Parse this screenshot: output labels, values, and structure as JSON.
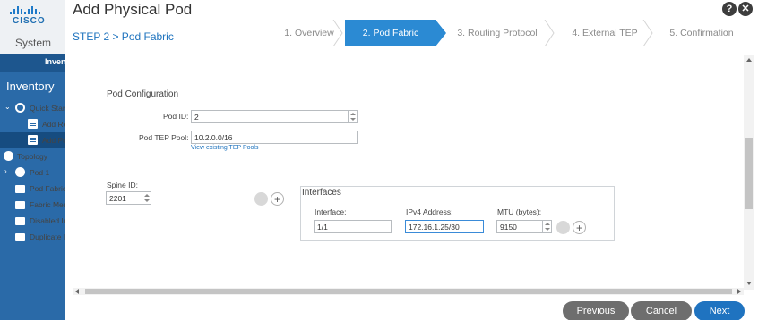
{
  "app": {
    "logo_text": "CISCO",
    "system_tab": "System",
    "inventory_tab": "Inventory",
    "inventory_heading": "Inventory",
    "tree": [
      {
        "label": "Quick Start",
        "icon": "quick-start-icon"
      },
      {
        "label": "Add Remote",
        "icon": "document-icon"
      },
      {
        "label": "Add Pod",
        "icon": "document-icon"
      },
      {
        "label": "Topology",
        "icon": "globe-icon"
      },
      {
        "label": "Pod 1",
        "icon": "globe-icon"
      },
      {
        "label": "Pod Fabric",
        "icon": "folder-icon"
      },
      {
        "label": "Fabric Membership",
        "icon": "folder-icon"
      },
      {
        "label": "Disabled Interfaces",
        "icon": "folder-icon"
      },
      {
        "label": "Duplicate IP",
        "icon": "folder-icon"
      }
    ]
  },
  "modal": {
    "title": "Add Physical Pod",
    "help_label": "?",
    "close_label": "✕",
    "step_label": "STEP 2 > Pod Fabric",
    "wizard_steps": [
      {
        "label": "1. Overview",
        "active": false
      },
      {
        "label": "2. Pod Fabric",
        "active": true
      },
      {
        "label": "3. Routing Protocol",
        "active": false
      },
      {
        "label": "4. External TEP",
        "active": false
      },
      {
        "label": "5. Confirmation",
        "active": false
      }
    ]
  },
  "form": {
    "section_title": "Pod Configuration",
    "pod_id": {
      "label": "Pod ID:",
      "value": "2"
    },
    "pod_tep_pool": {
      "label": "Pod TEP Pool:",
      "value": "10.2.0.0/16",
      "link": "View existing TEP Pools"
    },
    "spine_id": {
      "label": "Spine ID:",
      "value": "2201"
    },
    "interfaces": {
      "title": "Interfaces",
      "interface_label": "Interface:",
      "interface_value": "1/1",
      "ipv4_label": "IPv4 Address:",
      "ipv4_value": "172.16.1.25/30",
      "mtu_label": "MTU (bytes):",
      "mtu_value": "9150"
    },
    "add_icon_label": "+"
  },
  "footer": {
    "previous": "Previous",
    "cancel": "Cancel",
    "next": "Next"
  },
  "colors": {
    "sidebar": "#2a6aa8",
    "active_step": "#2b8ad3",
    "next_button": "#1f73c0",
    "secondary_button": "#6e6e6e",
    "link": "#1e73be"
  }
}
